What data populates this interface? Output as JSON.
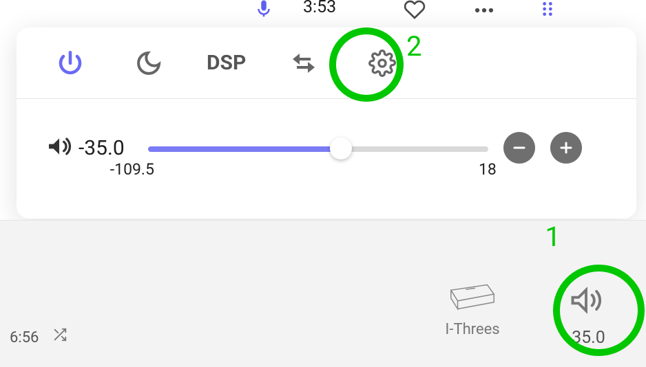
{
  "topbar": {
    "time": "3:53"
  },
  "panel": {
    "dsp_label": "DSP"
  },
  "volume": {
    "value": "-35.0",
    "min": "-109.5",
    "max": "18"
  },
  "bottom": {
    "elapsed": "6:56",
    "device_label": "I-Threes",
    "status_volume": "-35.0"
  },
  "annotations": {
    "n1": "1",
    "n2": "2"
  }
}
